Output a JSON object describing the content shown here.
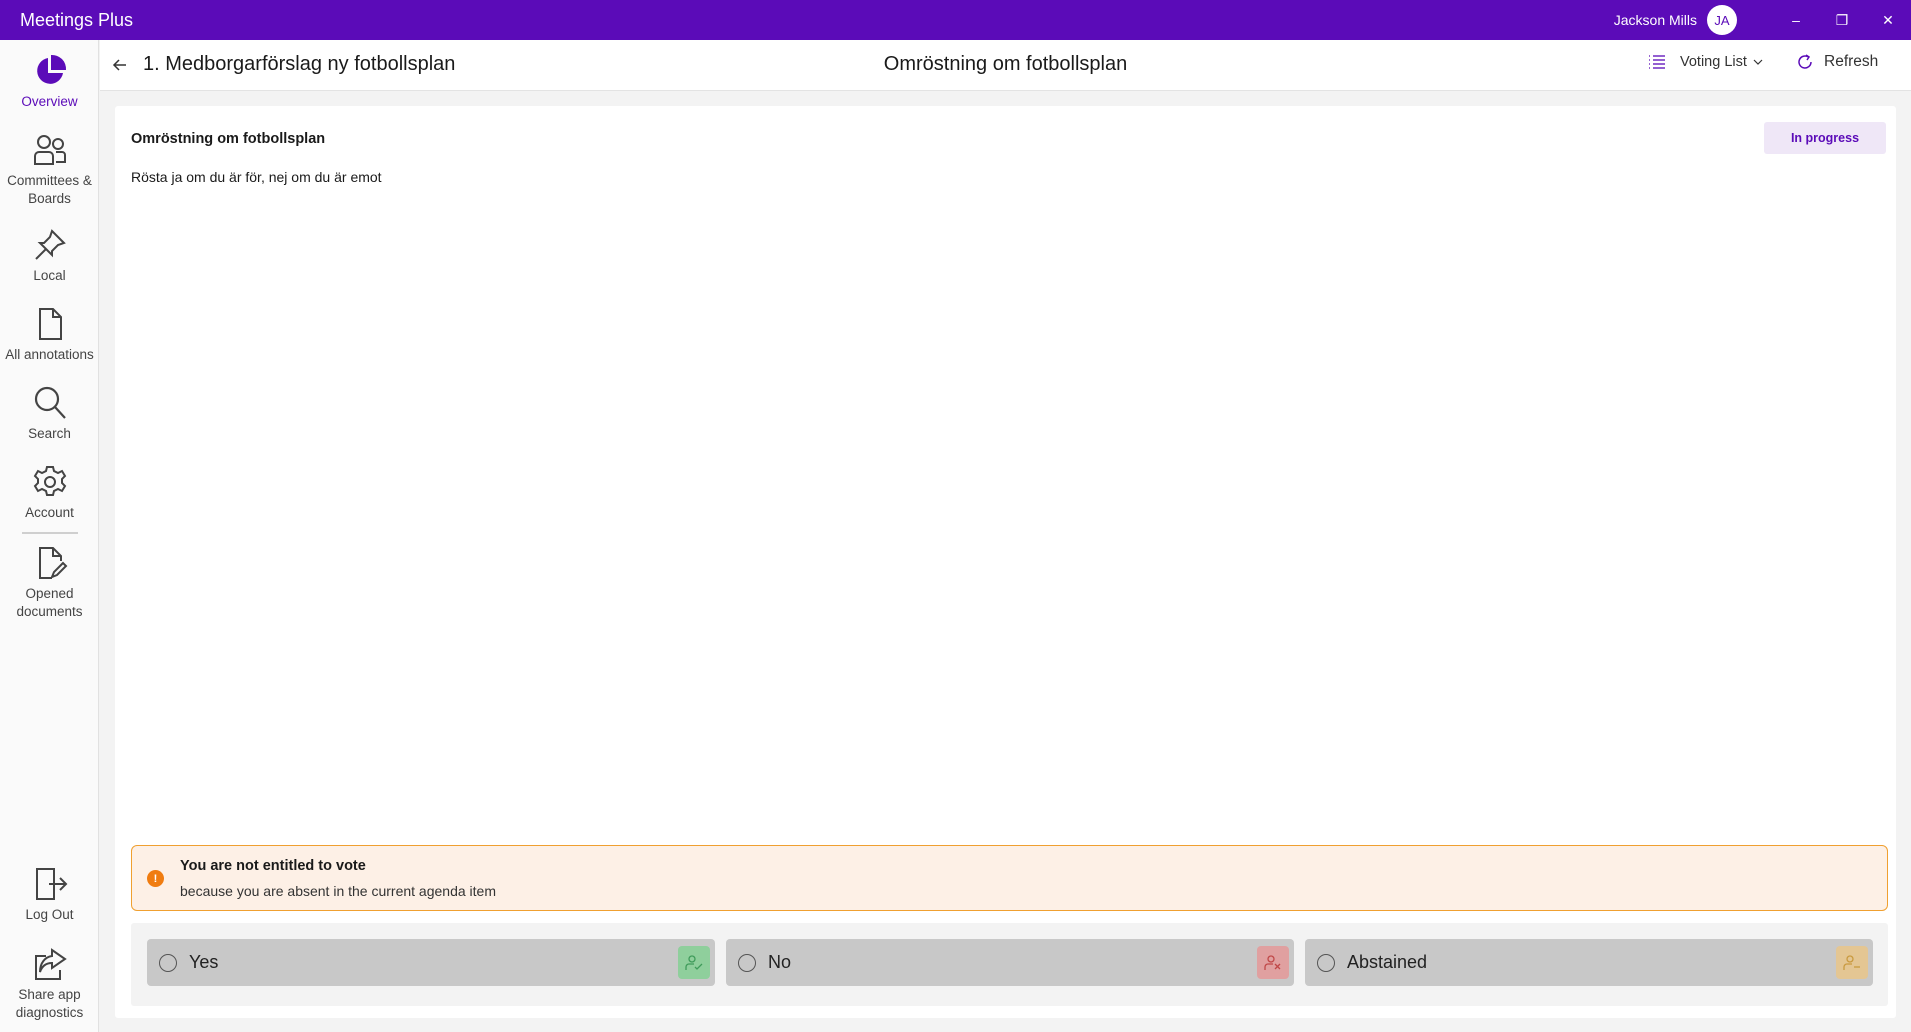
{
  "app": {
    "title": "Meetings Plus"
  },
  "user": {
    "name": "Jackson Mills",
    "initials": "JA"
  },
  "window_controls": {
    "minimize": "–",
    "restore": "❐",
    "close": "✕"
  },
  "sidebar": {
    "items": [
      {
        "label": "Overview",
        "icon": "pie-chart-icon",
        "active": true
      },
      {
        "label": "Committees & Boards",
        "icon": "people-icon"
      },
      {
        "label": "Local",
        "icon": "pin-icon"
      },
      {
        "label": "All annotations",
        "icon": "document-icon"
      },
      {
        "label": "Search",
        "icon": "search-icon"
      },
      {
        "label": "Account",
        "icon": "gear-icon"
      },
      {
        "label": "Opened documents",
        "icon": "document-edit-icon"
      },
      {
        "label": "Log Out",
        "icon": "logout-icon"
      },
      {
        "label": "Share app diagnostics",
        "icon": "share-icon"
      }
    ]
  },
  "header": {
    "breadcrumb": "1. Medborgarförslag ny fotbollsplan",
    "title": "Omröstning om fotbollsplan",
    "voting_list_label": "Voting List",
    "refresh_label": "Refresh"
  },
  "vote": {
    "title": "Omröstning om fotbollsplan",
    "description": "Rösta ja om du är för, nej om du är emot",
    "status": "In progress",
    "warning_title": "You are not entitled to vote",
    "warning_subtitle": "because you are absent in the current agenda item",
    "options": [
      {
        "label": "Yes",
        "color": "#5cc47c"
      },
      {
        "label": "No",
        "color": "#e07777"
      },
      {
        "label": "Abstained",
        "color": "#e8c07a"
      }
    ]
  },
  "colors": {
    "brand": "#5b0bb8",
    "warning_border": "#f0a030",
    "warning_bg": "#fdf0e6"
  }
}
